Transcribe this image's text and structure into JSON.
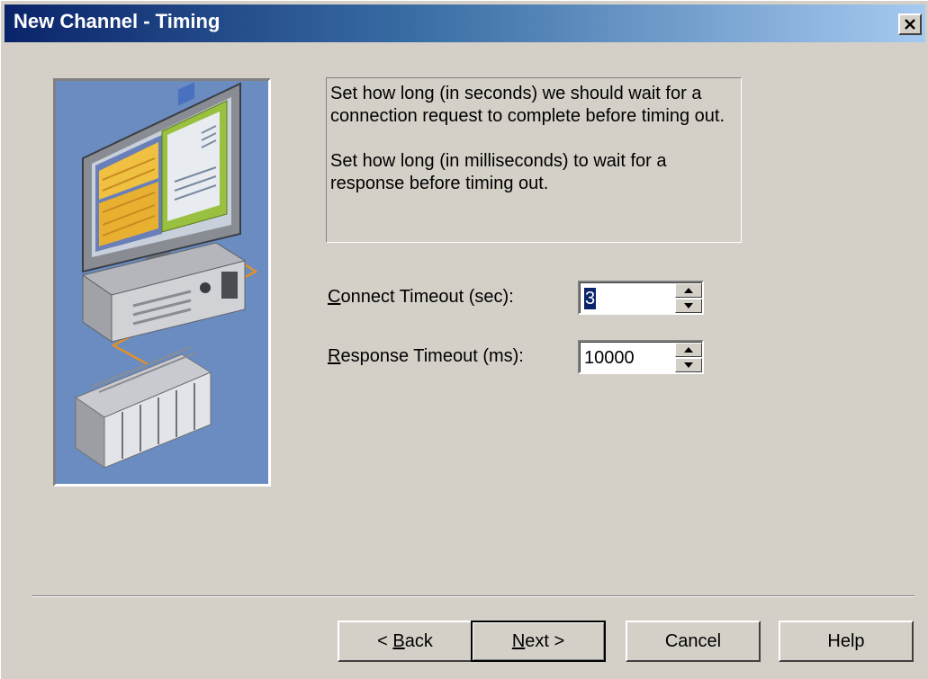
{
  "window": {
    "title": "New Channel - Timing",
    "close_glyph": "X"
  },
  "description": {
    "line1": "Set how long (in seconds) we should wait for a connection request to complete before timing out.",
    "line2": "Set how long (in milliseconds) to wait for a response before timing out."
  },
  "fields": {
    "connect_timeout": {
      "label_access_key": "C",
      "label_rest": "onnect Timeout (sec):",
      "value": "3"
    },
    "response_timeout": {
      "label_access_key": "R",
      "label_rest": "esponse Timeout (ms):",
      "value": "10000"
    }
  },
  "buttons": {
    "back_prefix": "< ",
    "back_key": "B",
    "back_rest": "ack",
    "next_key": "N",
    "next_rest": "ext >",
    "cancel": "Cancel",
    "help": "Help"
  },
  "icons": {
    "close": "close-icon",
    "spin_up": "arrow-up-icon",
    "spin_down": "arrow-down-icon",
    "illustration": "computer-plc-illustration"
  },
  "colors": {
    "title_gradient_start": "#0a246a",
    "title_gradient_end": "#a6caf0",
    "dialog_face": "#d4d0c8",
    "selection": "#0a246a"
  }
}
